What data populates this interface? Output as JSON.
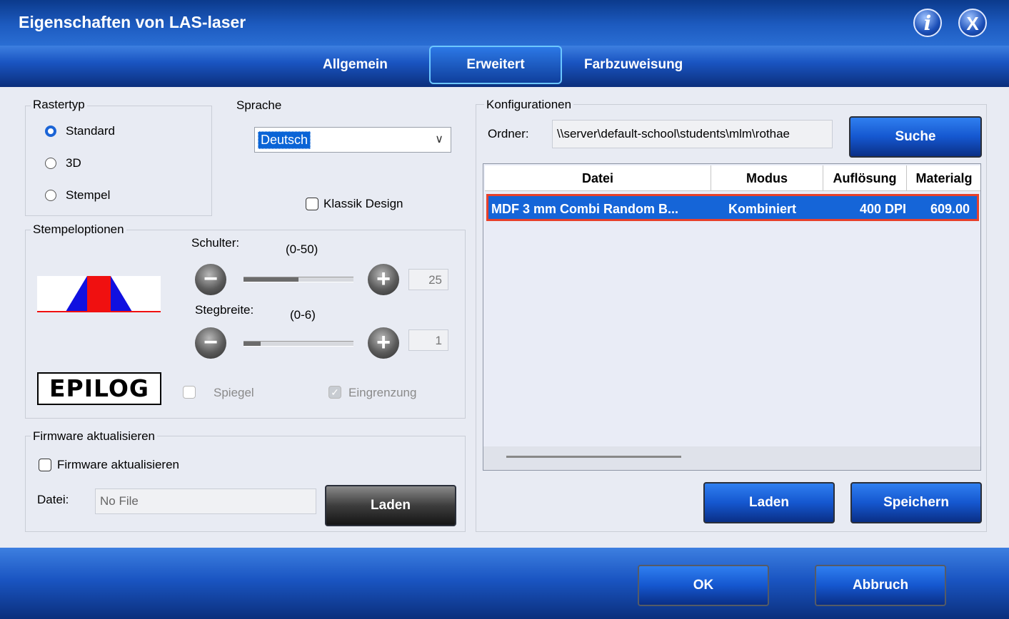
{
  "window": {
    "title": "Eigenschaften von LAS-laser",
    "info_icon": "info-icon",
    "close_icon": "close-icon"
  },
  "tabs": [
    {
      "label": "Allgemein",
      "active": false
    },
    {
      "label": "Erweitert",
      "active": true
    },
    {
      "label": "Farbzuweisung",
      "active": false
    }
  ],
  "rastertyp": {
    "label": "Rastertyp",
    "options": [
      {
        "label": "Standard",
        "selected": true
      },
      {
        "label": "3D",
        "selected": false
      },
      {
        "label": "Stempel",
        "selected": false
      }
    ]
  },
  "sprache": {
    "label": "Sprache",
    "value": "Deutsch"
  },
  "klassik_design": {
    "label": "Klassik Design",
    "checked": false
  },
  "stempeloptionen": {
    "label": "Stempeloptionen",
    "schulter": {
      "label": "Schulter:",
      "range": "(0-50)",
      "value": "25",
      "fraction": 0.5
    },
    "stegbreite": {
      "label": "Stegbreite:",
      "range": "(0-6)",
      "value": "1",
      "fraction": 0.17
    },
    "logo": "EPILOG",
    "spiegel": {
      "label": "Spiegel",
      "checked": false,
      "disabled": true
    },
    "eingrenzung": {
      "label": "Eingrenzung",
      "checked": true,
      "disabled": true
    }
  },
  "firmware": {
    "group_label": "Firmware aktualisieren",
    "checkbox_label": "Firmware aktualisieren",
    "checked": false,
    "datei_label": "Datei:",
    "datei_value": "No File",
    "laden_label": "Laden"
  },
  "konfigurationen": {
    "label": "Konfigurationen",
    "ordner_label": "Ordner:",
    "ordner_value": "\\\\server\\default-school\\students\\mlm\\rothae",
    "suche_label": "Suche",
    "columns": [
      "Datei",
      "Modus",
      "Auflösung",
      "Materialg"
    ],
    "rows": [
      {
        "datei": "MDF 3 mm Combi Random B...",
        "modus": "Kombiniert",
        "aufloesung": "400 DPI",
        "material": "609.00",
        "selected": true
      }
    ],
    "laden_label": "Laden",
    "speichern_label": "Speichern"
  },
  "footer": {
    "ok_label": "OK",
    "abbruch_label": "Abbruch"
  },
  "colors": {
    "accent": "#1565d8",
    "selection_border": "#e8412b",
    "titlebar": "#1d5bc0"
  }
}
